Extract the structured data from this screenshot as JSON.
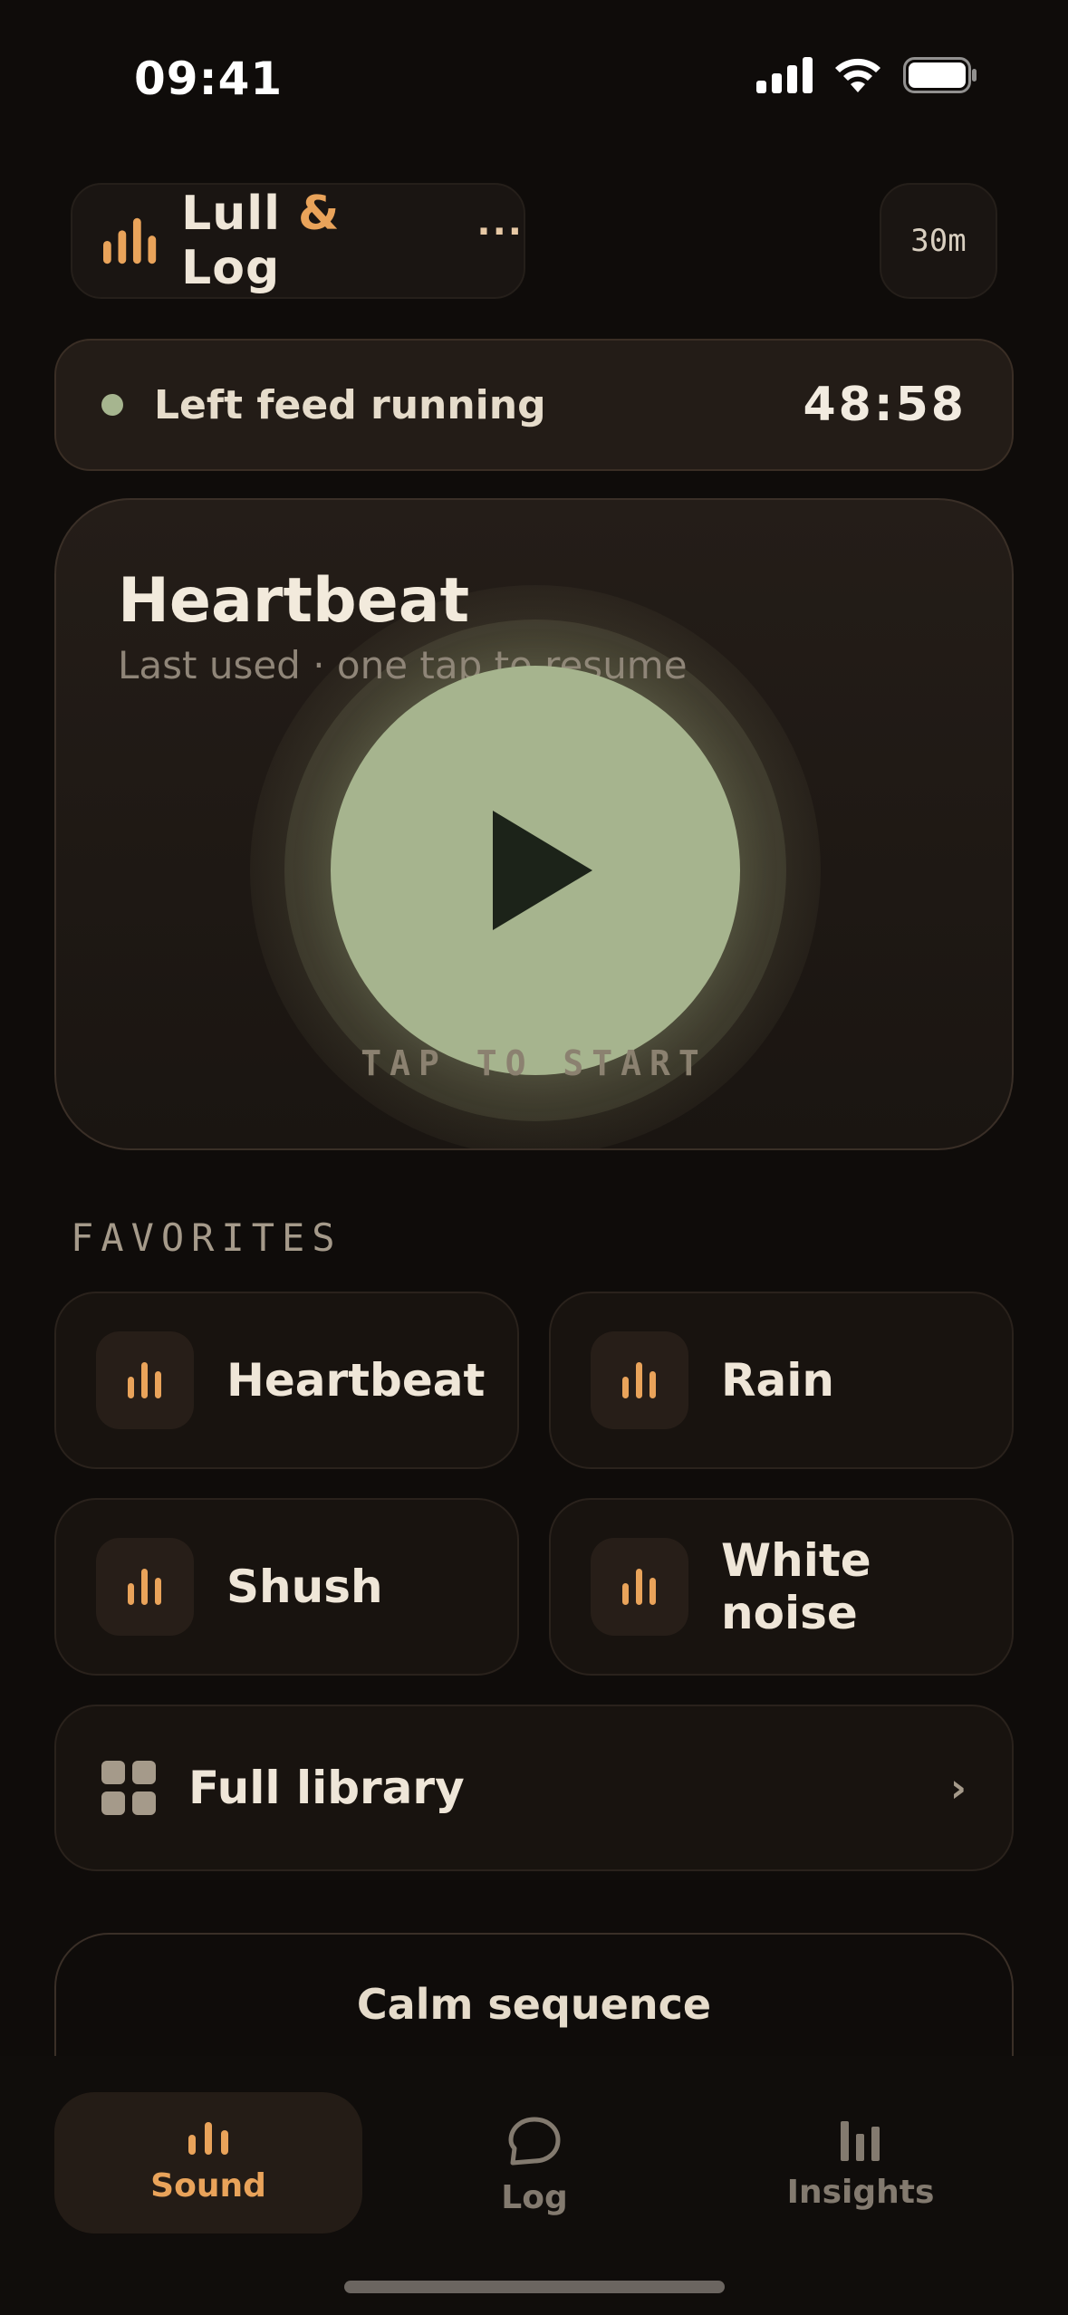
{
  "status_bar": {
    "time": "09:41"
  },
  "header": {
    "brand_first": "Lull",
    "brand_amp": "&",
    "brand_last": "Log",
    "more_label": "···",
    "timer_label": "30m"
  },
  "feed_banner": {
    "label": "Left feed running",
    "elapsed": "48:58"
  },
  "hero": {
    "title": "Heartbeat",
    "subtitle": "Last used · one tap to resume",
    "cta": "TAP TO START"
  },
  "favorites": {
    "heading": "FAVORITES",
    "items": [
      {
        "label": "Heartbeat"
      },
      {
        "label": "Rain"
      },
      {
        "label": "Shush"
      },
      {
        "label": "White noise"
      }
    ]
  },
  "library": {
    "label": "Full library",
    "chevron": "›"
  },
  "calm_sequence": {
    "label": "Calm sequence"
  },
  "tabs": [
    {
      "label": "Sound",
      "icon": "sound-bars-icon",
      "active": true
    },
    {
      "label": "Log",
      "icon": "chat-bubble-icon",
      "active": false
    },
    {
      "label": "Insights",
      "icon": "bar-chart-icon",
      "active": false
    }
  ],
  "colors": {
    "background": "#0f0c0a",
    "accent": "#e9a35a",
    "play": "#a6b48e",
    "status_dot": "#a6b58f"
  }
}
